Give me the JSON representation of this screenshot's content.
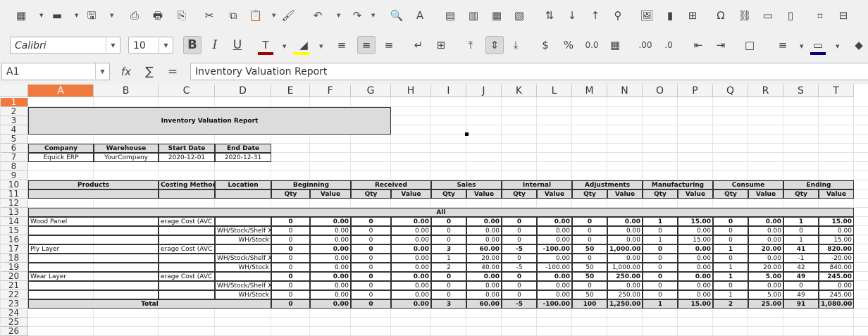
{
  "app": {
    "title": "LibreOffice Calc"
  },
  "toolbar": {
    "standard_icons": [
      "spreadsheet-icon",
      "open-folder-icon",
      "save-icon",
      "export-pdf-icon",
      "print-icon",
      "print-preview-icon",
      "cut-icon",
      "copy-icon",
      "paste-icon",
      "clone-formatting-icon",
      "undo-icon",
      "redo-icon",
      "find-replace-icon",
      "spelling-icon",
      "row-icon",
      "column-icon",
      "insert-rows-icon",
      "insert-columns-icon",
      "sort-icon",
      "sort-ascending-icon",
      "sort-descending-icon",
      "autofilter-icon",
      "insert-image-icon",
      "insert-chart-icon",
      "pivot-table-icon",
      "special-character-icon",
      "hyperlink-icon",
      "comment-icon",
      "headers-footers-icon",
      "define-print-area-icon",
      "freeze-icon"
    ],
    "standard_glyphs": [
      "▦",
      "▬",
      "🖫",
      "⎙",
      "🖶",
      "⎘",
      "✂",
      "⧉",
      "📋",
      "🖌",
      "↶",
      "↷",
      "🔍",
      "A",
      "▤",
      "▥",
      "▦",
      "▧",
      "⇅",
      "↓",
      "↑",
      "⚲",
      "🖼",
      "▮",
      "⊞",
      "Ω",
      "⛓",
      "▭",
      "▯",
      "⌗",
      "⊟"
    ],
    "font_name": "Calibri",
    "font_size": "10",
    "format_glyphs": [
      "B",
      "I",
      "U",
      "T",
      "◢",
      "≡",
      "≡",
      "≡",
      "↵",
      "⊞",
      "⤒",
      "⇕",
      "⤓",
      "$",
      "%",
      "0.0",
      "▦",
      ".00",
      ".0",
      "⇤",
      "⇥",
      "□",
      "≡",
      "▭",
      "◆"
    ],
    "format_icons": [
      "bold-icon",
      "italic-icon",
      "underline-icon",
      "font-color-icon",
      "highlight-icon",
      "align-left-icon",
      "align-center-icon",
      "align-right-icon",
      "wrap-text-icon",
      "merge-cells-icon",
      "align-top-icon",
      "center-vertically-icon",
      "align-bottom-icon",
      "currency-icon",
      "percent-icon",
      "number-format-icon",
      "date-format-icon",
      "add-decimal-icon",
      "delete-decimal-icon",
      "increase-indent-icon",
      "decrease-indent-icon",
      "borders-icon",
      "border-style-icon",
      "border-color-icon",
      "conditional-icon"
    ],
    "colors": {
      "font_color": "#a50000",
      "highlight": "#ffff00",
      "border_color": "#000080",
      "selection": "#f07a3e"
    }
  },
  "formula_bar": {
    "name_box": "A1",
    "function_wizard_glyph": "fx",
    "sum_glyph": "∑",
    "equals_glyph": "=",
    "content": "Inventory Valuation Report"
  },
  "sheet": {
    "columns": [
      "A",
      "B",
      "C",
      "D",
      "E",
      "F",
      "G",
      "H",
      "I",
      "J",
      "K",
      "L",
      "M",
      "N",
      "O",
      "P",
      "Q",
      "R",
      "S",
      "T"
    ],
    "rows": [
      "1",
      "2",
      "3",
      "4",
      "5",
      "6",
      "7",
      "8",
      "9",
      "10",
      "11",
      "12",
      "13",
      "14",
      "15",
      "16",
      "17",
      "18",
      "19",
      "20",
      "21",
      "22",
      "23",
      "24",
      "25",
      "26"
    ],
    "report_title": "Inventory Valuation Report",
    "info_headers": [
      "Company",
      "Warehouse",
      "Start Date",
      "End Date"
    ],
    "info_values": [
      "Equick ERP",
      "YourCompany",
      "2020-12-01",
      "2020-12-31"
    ],
    "table_headers": {
      "products": "Products",
      "costing": "Costing Method",
      "location": "Location"
    },
    "groups": [
      "Beginning",
      "Received",
      "Sales",
      "Internal",
      "Adjustments",
      "Manufacturing",
      "Consume",
      "Ending"
    ],
    "sub_headers": [
      "Qty",
      "Value"
    ],
    "all_label": "All",
    "data_rows": [
      {
        "product": "Wood Panel",
        "costing": "erage Cost (AVC",
        "location": "",
        "bold": true,
        "vals": [
          "0",
          "0.00",
          "0",
          "0.00",
          "0",
          "0.00",
          "0",
          "0.00",
          "0",
          "0.00",
          "1",
          "15.00",
          "0",
          "0.00",
          "1",
          "15.00"
        ]
      },
      {
        "product": "",
        "costing": "",
        "location": "WH/Stock/Shelf X",
        "bold": false,
        "vals": [
          "0",
          "0.00",
          "0",
          "0.00",
          "0",
          "0.00",
          "0",
          "0.00",
          "0",
          "0.00",
          "0",
          "0.00",
          "0",
          "0.00",
          "0",
          "0.00"
        ]
      },
      {
        "product": "",
        "costing": "",
        "location": "WH/Stock",
        "bold": false,
        "vals": [
          "0",
          "0.00",
          "0",
          "0.00",
          "0",
          "0.00",
          "0",
          "0.00",
          "0",
          "0.00",
          "1",
          "15.00",
          "0",
          "0.00",
          "1",
          "15.00"
        ]
      },
      {
        "product": "Ply Layer",
        "costing": "erage Cost (AVC",
        "location": "",
        "bold": true,
        "vals": [
          "0",
          "0.00",
          "0",
          "0.00",
          "3",
          "60.00",
          "-5",
          "-100.00",
          "50",
          "1,000.00",
          "0",
          "0.00",
          "1",
          "20.00",
          "41",
          "820.00"
        ]
      },
      {
        "product": "",
        "costing": "",
        "location": "WH/Stock/Shelf X",
        "bold": false,
        "vals": [
          "0",
          "0.00",
          "0",
          "0.00",
          "1",
          "20.00",
          "0",
          "0.00",
          "0",
          "0.00",
          "0",
          "0.00",
          "0",
          "0.00",
          "-1",
          "-20.00"
        ]
      },
      {
        "product": "",
        "costing": "",
        "location": "WH/Stock",
        "bold": false,
        "vals": [
          "0",
          "0.00",
          "0",
          "0.00",
          "2",
          "40.00",
          "-5",
          "-100.00",
          "50",
          "1,000.00",
          "0",
          "0.00",
          "1",
          "20.00",
          "42",
          "840.00"
        ]
      },
      {
        "product": "Wear Layer",
        "costing": "erage Cost (AVC",
        "location": "",
        "bold": true,
        "vals": [
          "0",
          "0.00",
          "0",
          "0.00",
          "0",
          "0.00",
          "0",
          "0.00",
          "50",
          "250.00",
          "0",
          "0.00",
          "1",
          "5.00",
          "49",
          "245.00"
        ]
      },
      {
        "product": "",
        "costing": "",
        "location": "WH/Stock/Shelf X",
        "bold": false,
        "vals": [
          "0",
          "0.00",
          "0",
          "0.00",
          "0",
          "0.00",
          "0",
          "0.00",
          "0",
          "0.00",
          "0",
          "0.00",
          "0",
          "0.00",
          "0",
          "0.00"
        ]
      },
      {
        "product": "",
        "costing": "",
        "location": "WH/Stock",
        "bold": false,
        "vals": [
          "0",
          "0.00",
          "0",
          "0.00",
          "0",
          "0.00",
          "0",
          "0.00",
          "50",
          "250.00",
          "0",
          "0.00",
          "1",
          "5.00",
          "49",
          "245.00"
        ]
      }
    ],
    "total_row": {
      "label": "Total",
      "vals": [
        "0",
        "0.00",
        "0",
        "0.00",
        "3",
        "60.00",
        "-5",
        "-100.00",
        "100",
        "1,250.00",
        "1",
        "15.00",
        "2",
        "25.00",
        "91",
        "1,080.00"
      ]
    }
  }
}
